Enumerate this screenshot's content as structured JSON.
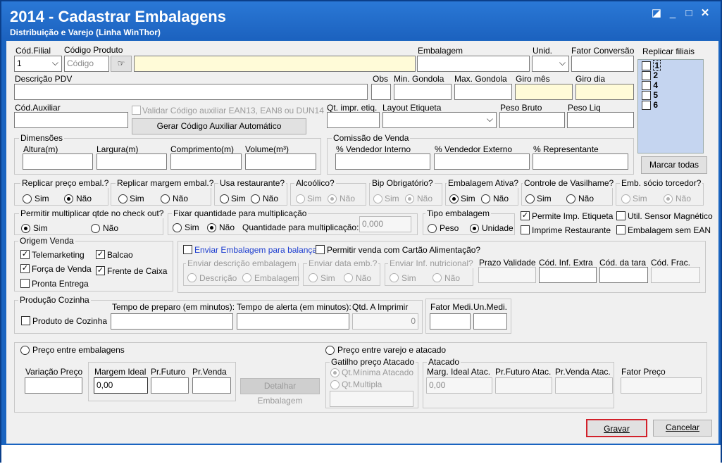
{
  "window": {
    "title": "2014 - Cadastrar Embalagens",
    "subtitle": "Distribuição e Varejo (Linha WinThor)"
  },
  "header": {
    "cod_filial_label": "Cód.Filial",
    "cod_filial_value": "1",
    "codigo_produto_label": "Código Produto",
    "codigo_placeholder": "Código",
    "embalagem_label": "Embalagem",
    "unid_label": "Unid.",
    "fator_conversao_label": "Fator Conversão"
  },
  "replicar": {
    "label": "Replicar filiais",
    "items": [
      "1",
      "2",
      "4",
      "5",
      "6"
    ],
    "marcar_todas": "Marcar todas"
  },
  "row2": {
    "descricao_pdv": "Descrição PDV",
    "obs": "Obs",
    "min_gondola": "Min. Gondola",
    "max_gondola": "Max. Gondola",
    "giro_mes": "Giro mês",
    "giro_dia": "Giro dia"
  },
  "row3": {
    "cod_auxiliar": "Cód.Auxiliar",
    "validar": "Validar Código auxiliar EAN13, EAN8 ou DUN14",
    "gerar": "Gerar Código Auxiliar Automático",
    "qt_impr": "Qt. impr. etiq.",
    "layout_etiqueta": "Layout Etiqueta",
    "peso_bruto": "Peso Bruto",
    "peso_liq": "Peso Liq"
  },
  "dimensoes": {
    "title": "Dimensões",
    "altura": "Altura(m)",
    "largura": "Largura(m)",
    "comprimento": "Comprimento(m)",
    "volume": "Volume(m³)"
  },
  "comissao": {
    "title": "Comissão de Venda",
    "vend_interno": "% Vendedor Interno",
    "vend_externo": "% Vendedor Externo",
    "representante": "% Representante"
  },
  "opts": {
    "sim": "Sim",
    "nao": "Não",
    "replicar_preco": "Replicar preço embal.?",
    "replicar_margem": "Replicar margem embal.?",
    "usa_restaurante": "Usa restaurante?",
    "alcoolico": "Alcoólico?",
    "bip": "Bip Obrigatório?",
    "embalagem_ativa": "Embalagem Ativa?",
    "controle_vasilhame": "Controle de Vasilhame?",
    "emb_socio": "Emb. sócio torcedor?"
  },
  "row5": {
    "permitir_mult": "Permitir multiplicar qtde no check out?",
    "fixar_qtde": "Fixar quantidade para multiplicação",
    "qtde_mult_label": "Quantidade para multiplicação:",
    "qtde_mult_value": "0,000",
    "tipo_embalagem": "Tipo embalagem",
    "peso": "Peso",
    "unidade": "Unidade",
    "permite_imp_etiqueta": "Permite Imp. Etiqueta",
    "util_sensor": "Util. Sensor Magnético",
    "imprime_restaurante": "Imprime Restaurante",
    "embalagem_sem_ean": "Embalagem sem EAN"
  },
  "origem": {
    "title": "Origem Venda",
    "telemarketing": "Telemarketing",
    "balcao": "Balcao",
    "forca_venda": "Força de Venda",
    "frente_caixa": "Frente de Caixa",
    "pronta_entrega": "Pronta Entrega"
  },
  "balanca": {
    "enviar_balanca": "Enviar Embalagem para balança",
    "permitir_cartao": "Permitir venda com Cartão Alimentação?",
    "enviar_descricao": "Enviar descrição embalagem",
    "descricao": "Descrição",
    "embalagem": "Embalagem",
    "enviar_data": "Enviar data emb.?",
    "enviar_inf": "Enviar Inf. nutricional?",
    "prazo_validade": "Prazo Validade",
    "cod_inf_extra": "Cód. Inf. Extra",
    "cod_tara": "Cód. da tara",
    "cod_frac": "Cód. Frac."
  },
  "producao": {
    "title": "Produção Cozinha",
    "produto_cozinha": "Produto de Cozinha",
    "tempo_preparo": "Tempo de preparo (em minutos):",
    "tempo_alerta": "Tempo de alerta (em minutos):",
    "qtd_imprimir": "Qtd. A Imprimir",
    "qtd_value": "0",
    "fator_medi": "Fator Medi.",
    "un_medi": "Un.Medi."
  },
  "preco": {
    "preco_entre_embalagens": "Preço entre embalagens",
    "variacao_preco": "Variação Preço",
    "margem_ideal": "Margem Ideal",
    "margem_value": "0,00",
    "pr_futuro": "Pr.Futuro",
    "pr_venda": "Pr.Venda",
    "detalhar": "Detalhar Embalagem",
    "preco_varejo_atacado": "Preço entre varejo e atacado",
    "gatilho": "Gatilho preço Atacado",
    "qt_minima": "Qt.Mínima Atacado",
    "qt_multipla": "Qt.Multipla",
    "atacado": "Atacado",
    "marg_ideal_atac": "Marg. Ideal Atac.",
    "marg_value": "0,00",
    "pr_futuro_atac": "Pr.Futuro Atac.",
    "pr_venda_atac": "Pr.Venda Atac.",
    "fator_preco": "Fator Preço"
  },
  "footer": {
    "gravar": "Gravar",
    "cancelar": "Cancelar"
  }
}
